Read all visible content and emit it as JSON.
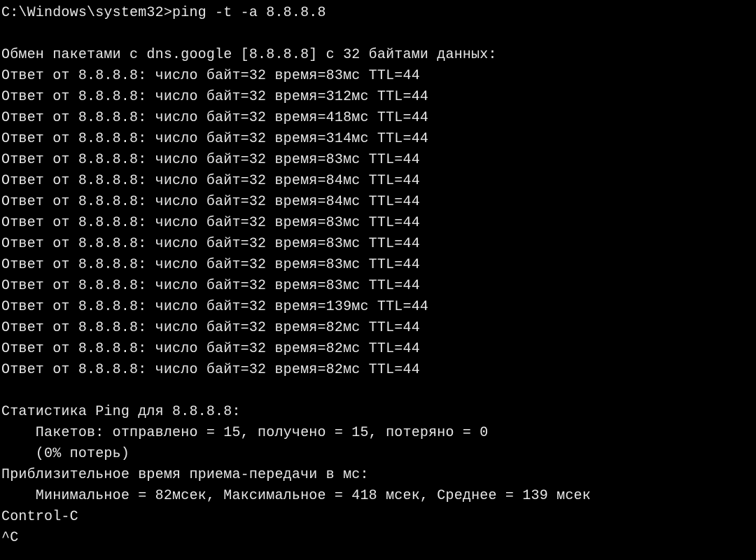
{
  "prompt": {
    "path": "C:\\Windows\\system32>",
    "command": "ping -t -a 8.8.8.8"
  },
  "blank1": "",
  "exchange_header": "Обмен пакетами с dns.google [8.8.8.8] с 32 байтами данных:",
  "exchange": {
    "hostname": "dns.google",
    "address": "8.8.8.8",
    "bytes": 32
  },
  "reply_template": {
    "prefix": "Ответ от ",
    "from": "8.8.8.8",
    "bytes_label": "число байт=",
    "time_label": "время=",
    "time_unit": "мс",
    "ttl_label": "TTL=",
    "ttl": 44,
    "bytes": 32
  },
  "replies": [
    {
      "time": 83
    },
    {
      "time": 312
    },
    {
      "time": 418
    },
    {
      "time": 314
    },
    {
      "time": 83
    },
    {
      "time": 84
    },
    {
      "time": 84
    },
    {
      "time": 83
    },
    {
      "time": 83
    },
    {
      "time": 83
    },
    {
      "time": 83
    },
    {
      "time": 139
    },
    {
      "time": 82
    },
    {
      "time": 82
    },
    {
      "time": 82
    }
  ],
  "blank2": "",
  "stats": {
    "header": "Статистика Ping для 8.8.8.8:",
    "packets_line": "    Пакетов: отправлено = 15, получено = 15, потеряно = 0",
    "loss_line": "    (0% потерь)",
    "rtt_header": "Приблизительное время приема-передачи в мс:",
    "rtt_line": "    Минимальное = 82мсек, Максимальное = 418 мсек, Среднее = 139 мсек",
    "sent": 15,
    "received": 15,
    "lost": 0,
    "loss_percent": 0,
    "min_ms": 82,
    "max_ms": 418,
    "avg_ms": 139
  },
  "interrupt": {
    "name": "Control-C",
    "caret": "^C"
  }
}
